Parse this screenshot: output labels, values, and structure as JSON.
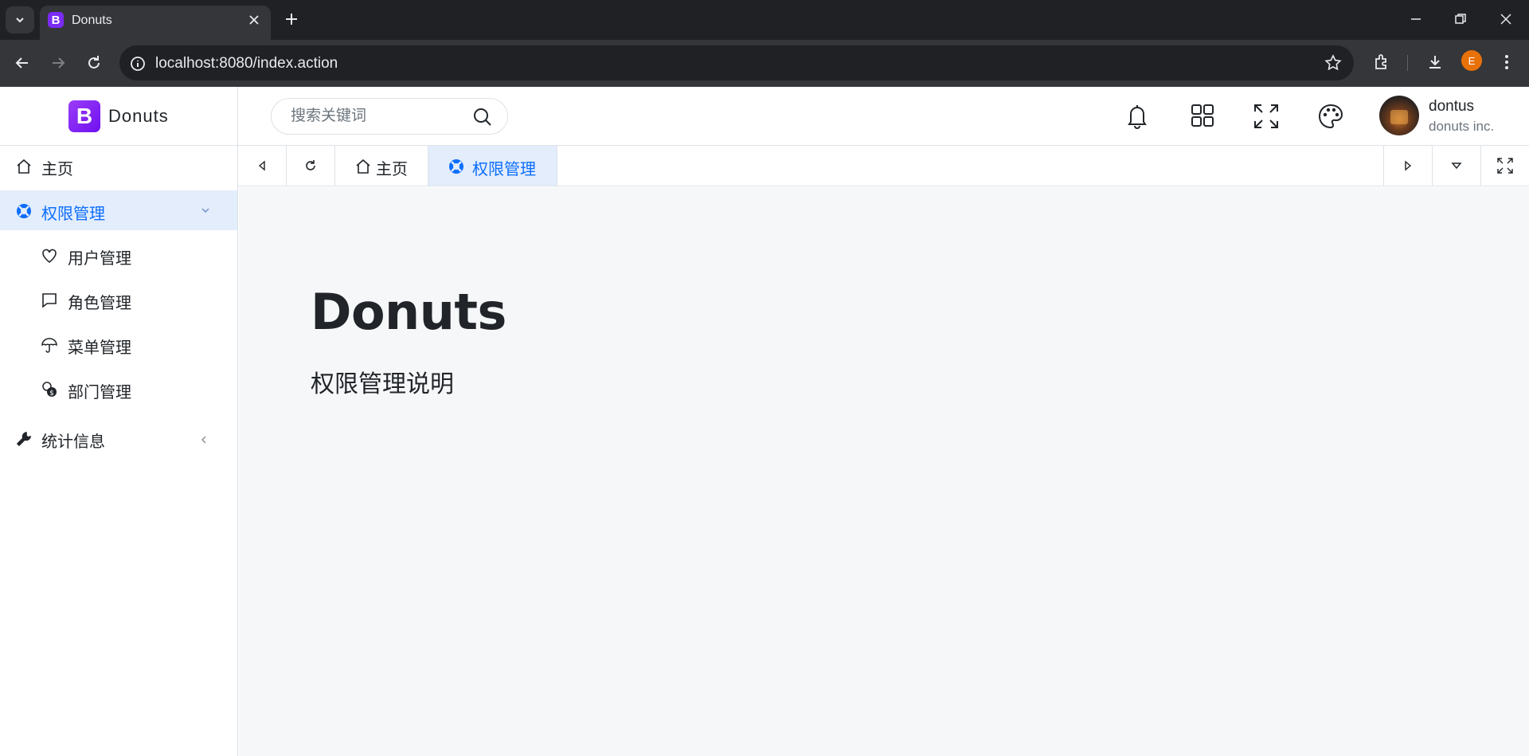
{
  "browser": {
    "tab_title": "Donuts",
    "tab_favicon_letter": "B",
    "url": "localhost:8080/index.action",
    "profile_letter": "E"
  },
  "brand": {
    "logo_letter": "B",
    "name": "Donuts",
    "color": "#7a2bf5"
  },
  "header": {
    "search_placeholder": "搜索关键词",
    "icons": [
      "bell-icon",
      "grid-icon",
      "fullscreen-icon",
      "palette-icon"
    ],
    "user": {
      "name": "dontus",
      "company": "donuts inc."
    }
  },
  "sidebar": {
    "items": [
      {
        "label": "主页",
        "icon": "home-icon"
      },
      {
        "label": "权限管理",
        "icon": "lifebuoy-icon",
        "active": true,
        "expanded": true,
        "children": [
          {
            "label": "用户管理",
            "icon": "heart-icon"
          },
          {
            "label": "角色管理",
            "icon": "chat-icon"
          },
          {
            "label": "菜单管理",
            "icon": "umbrella-icon"
          },
          {
            "label": "部门管理",
            "icon": "coins-icon"
          }
        ]
      },
      {
        "label": "统计信息",
        "icon": "wrench-icon"
      }
    ]
  },
  "page_tabs": [
    {
      "label": "主页",
      "icon": "home-icon"
    },
    {
      "label": "权限管理",
      "icon": "lifebuoy-icon",
      "active": true
    }
  ],
  "content": {
    "title": "Donuts",
    "subtitle": "权限管理说明"
  },
  "colors": {
    "accent": "#0d6efd",
    "active_bg": "#e3edfc",
    "content_bg": "#f6f7f9"
  }
}
